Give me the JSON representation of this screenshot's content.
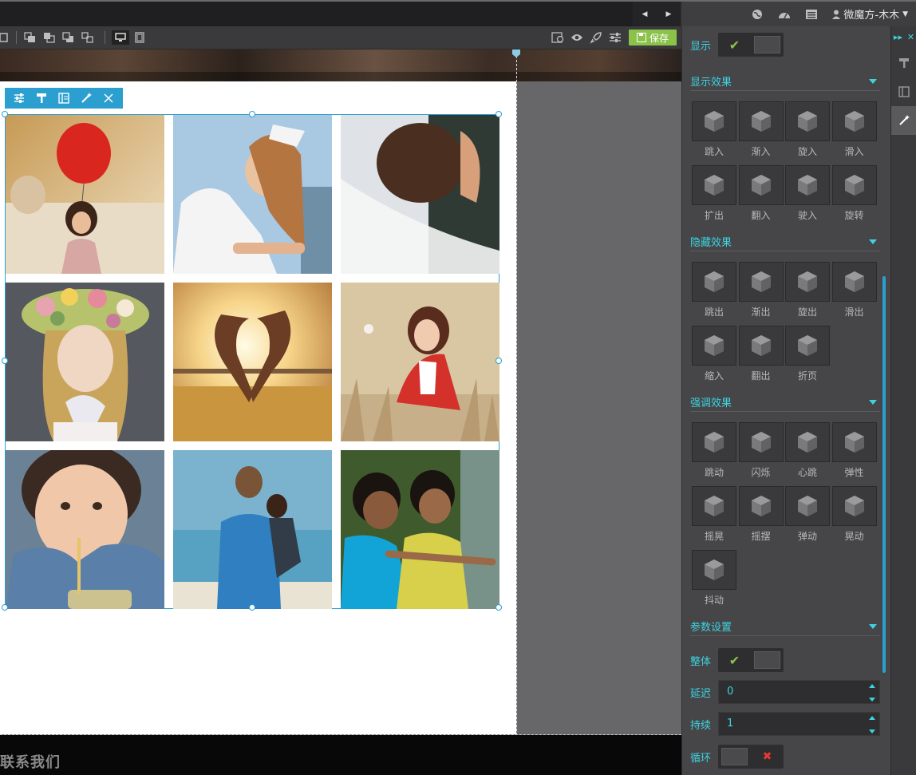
{
  "topbar": {
    "user_name": "微魔方-木木",
    "icons": [
      "globe-icon",
      "dashboard-icon",
      "list-icon",
      "user-icon"
    ]
  },
  "toolbar2": {
    "save_label": "保存",
    "icons": [
      "layer-icon",
      "bring-front-icon",
      "send-back-icon",
      "group-icon",
      "desktop-icon",
      "mobile-icon",
      "preview-icon",
      "eye-icon",
      "rocket-icon",
      "settings-icon"
    ]
  },
  "footer": {
    "text": "联系我们"
  },
  "element_toolbar": {
    "icons": [
      "sliders-icon",
      "paint-roller-icon",
      "layout-icon",
      "magic-wand-icon",
      "close-icon"
    ]
  },
  "photos": [
    {
      "desc": "girl-with-red-balloon",
      "colors": [
        "#d8b27a",
        "#c83b2e",
        "#f0e3c8"
      ]
    },
    {
      "desc": "couple-hug",
      "colors": [
        "#a9c8e2",
        "#c48a58",
        "#ffffff"
      ]
    },
    {
      "desc": "bride-veil",
      "colors": [
        "#d9dde2",
        "#6b4a36",
        "#f2f2f2"
      ]
    },
    {
      "desc": "girl-flower-crown",
      "colors": [
        "#5b5d63",
        "#d3b04c",
        "#f0e7e1"
      ]
    },
    {
      "desc": "heart-silhouette-sunset",
      "colors": [
        "#f5d98a",
        "#c98a3b",
        "#6a4520"
      ]
    },
    {
      "desc": "woman-in-field",
      "colors": [
        "#d6c4a0",
        "#d23a2c",
        "#8a6a47"
      ]
    },
    {
      "desc": "child-drinking",
      "colors": [
        "#5e7a90",
        "#e8b999",
        "#2b3e55"
      ]
    },
    {
      "desc": "father-child-beach",
      "colors": [
        "#7bb3cf",
        "#3b86c4",
        "#e5e0d2"
      ]
    },
    {
      "desc": "kids-splashing-water",
      "colors": [
        "#3f5a2c",
        "#1aa6d6",
        "#d9d14a"
      ]
    }
  ],
  "panel": {
    "show_label": "显示",
    "show_on": true,
    "sections": {
      "show_effects": {
        "title": "显示效果",
        "items": [
          "跳入",
          "渐入",
          "旋入",
          "滑入",
          "扩出",
          "翻入",
          "驶入",
          "旋转"
        ]
      },
      "hide_effects": {
        "title": "隐藏效果",
        "items": [
          "跳出",
          "渐出",
          "旋出",
          "滑出",
          "缩入",
          "翻出",
          "折页"
        ]
      },
      "emphasis_effects": {
        "title": "强调效果",
        "items": [
          "跳动",
          "闪烁",
          "心跳",
          "弹性",
          "摇晃",
          "摇摆",
          "弹动",
          "晃动",
          "抖动"
        ]
      },
      "params": {
        "title": "参数设置",
        "whole_label": "整体",
        "whole_on": true,
        "delay_label": "延迟",
        "delay_value": "0",
        "duration_label": "持续",
        "duration_value": "1",
        "loop_label": "循环",
        "loop_on": false
      }
    }
  },
  "strip": {
    "icons": [
      "collapse-panel-icon",
      "close-icon",
      "paint-roller-icon",
      "layout-icon",
      "magic-wand-icon"
    ],
    "active": "magic-wand-icon"
  },
  "colors": {
    "accent": "#3dd3e0",
    "selection": "#2a9fd0",
    "save_green": "#8bc34a",
    "toggle_off_x": "#e53935"
  }
}
